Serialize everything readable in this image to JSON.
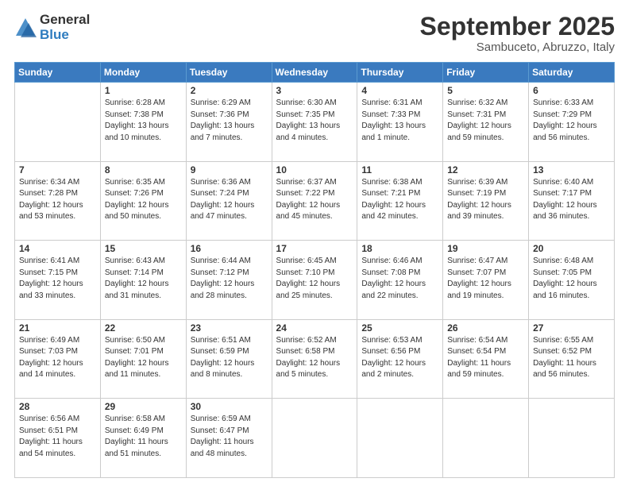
{
  "logo": {
    "general": "General",
    "blue": "Blue"
  },
  "title": "September 2025",
  "location": "Sambuceto, Abruzzo, Italy",
  "header_days": [
    "Sunday",
    "Monday",
    "Tuesday",
    "Wednesday",
    "Thursday",
    "Friday",
    "Saturday"
  ],
  "weeks": [
    [
      {
        "day": "",
        "info": ""
      },
      {
        "day": "1",
        "info": "Sunrise: 6:28 AM\nSunset: 7:38 PM\nDaylight: 13 hours\nand 10 minutes."
      },
      {
        "day": "2",
        "info": "Sunrise: 6:29 AM\nSunset: 7:36 PM\nDaylight: 13 hours\nand 7 minutes."
      },
      {
        "day": "3",
        "info": "Sunrise: 6:30 AM\nSunset: 7:35 PM\nDaylight: 13 hours\nand 4 minutes."
      },
      {
        "day": "4",
        "info": "Sunrise: 6:31 AM\nSunset: 7:33 PM\nDaylight: 13 hours\nand 1 minute."
      },
      {
        "day": "5",
        "info": "Sunrise: 6:32 AM\nSunset: 7:31 PM\nDaylight: 12 hours\nand 59 minutes."
      },
      {
        "day": "6",
        "info": "Sunrise: 6:33 AM\nSunset: 7:29 PM\nDaylight: 12 hours\nand 56 minutes."
      }
    ],
    [
      {
        "day": "7",
        "info": "Sunrise: 6:34 AM\nSunset: 7:28 PM\nDaylight: 12 hours\nand 53 minutes."
      },
      {
        "day": "8",
        "info": "Sunrise: 6:35 AM\nSunset: 7:26 PM\nDaylight: 12 hours\nand 50 minutes."
      },
      {
        "day": "9",
        "info": "Sunrise: 6:36 AM\nSunset: 7:24 PM\nDaylight: 12 hours\nand 47 minutes."
      },
      {
        "day": "10",
        "info": "Sunrise: 6:37 AM\nSunset: 7:22 PM\nDaylight: 12 hours\nand 45 minutes."
      },
      {
        "day": "11",
        "info": "Sunrise: 6:38 AM\nSunset: 7:21 PM\nDaylight: 12 hours\nand 42 minutes."
      },
      {
        "day": "12",
        "info": "Sunrise: 6:39 AM\nSunset: 7:19 PM\nDaylight: 12 hours\nand 39 minutes."
      },
      {
        "day": "13",
        "info": "Sunrise: 6:40 AM\nSunset: 7:17 PM\nDaylight: 12 hours\nand 36 minutes."
      }
    ],
    [
      {
        "day": "14",
        "info": "Sunrise: 6:41 AM\nSunset: 7:15 PM\nDaylight: 12 hours\nand 33 minutes."
      },
      {
        "day": "15",
        "info": "Sunrise: 6:43 AM\nSunset: 7:14 PM\nDaylight: 12 hours\nand 31 minutes."
      },
      {
        "day": "16",
        "info": "Sunrise: 6:44 AM\nSunset: 7:12 PM\nDaylight: 12 hours\nand 28 minutes."
      },
      {
        "day": "17",
        "info": "Sunrise: 6:45 AM\nSunset: 7:10 PM\nDaylight: 12 hours\nand 25 minutes."
      },
      {
        "day": "18",
        "info": "Sunrise: 6:46 AM\nSunset: 7:08 PM\nDaylight: 12 hours\nand 22 minutes."
      },
      {
        "day": "19",
        "info": "Sunrise: 6:47 AM\nSunset: 7:07 PM\nDaylight: 12 hours\nand 19 minutes."
      },
      {
        "day": "20",
        "info": "Sunrise: 6:48 AM\nSunset: 7:05 PM\nDaylight: 12 hours\nand 16 minutes."
      }
    ],
    [
      {
        "day": "21",
        "info": "Sunrise: 6:49 AM\nSunset: 7:03 PM\nDaylight: 12 hours\nand 14 minutes."
      },
      {
        "day": "22",
        "info": "Sunrise: 6:50 AM\nSunset: 7:01 PM\nDaylight: 12 hours\nand 11 minutes."
      },
      {
        "day": "23",
        "info": "Sunrise: 6:51 AM\nSunset: 6:59 PM\nDaylight: 12 hours\nand 8 minutes."
      },
      {
        "day": "24",
        "info": "Sunrise: 6:52 AM\nSunset: 6:58 PM\nDaylight: 12 hours\nand 5 minutes."
      },
      {
        "day": "25",
        "info": "Sunrise: 6:53 AM\nSunset: 6:56 PM\nDaylight: 12 hours\nand 2 minutes."
      },
      {
        "day": "26",
        "info": "Sunrise: 6:54 AM\nSunset: 6:54 PM\nDaylight: 11 hours\nand 59 minutes."
      },
      {
        "day": "27",
        "info": "Sunrise: 6:55 AM\nSunset: 6:52 PM\nDaylight: 11 hours\nand 56 minutes."
      }
    ],
    [
      {
        "day": "28",
        "info": "Sunrise: 6:56 AM\nSunset: 6:51 PM\nDaylight: 11 hours\nand 54 minutes."
      },
      {
        "day": "29",
        "info": "Sunrise: 6:58 AM\nSunset: 6:49 PM\nDaylight: 11 hours\nand 51 minutes."
      },
      {
        "day": "30",
        "info": "Sunrise: 6:59 AM\nSunset: 6:47 PM\nDaylight: 11 hours\nand 48 minutes."
      },
      {
        "day": "",
        "info": ""
      },
      {
        "day": "",
        "info": ""
      },
      {
        "day": "",
        "info": ""
      },
      {
        "day": "",
        "info": ""
      }
    ]
  ]
}
